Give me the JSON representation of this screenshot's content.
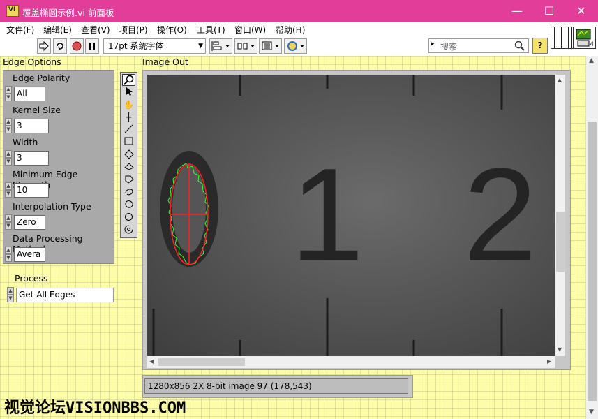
{
  "window": {
    "title": "覆盖椭圆示例.vi 前面板",
    "icon_text": "VI",
    "minimize_glyph": "—",
    "maximize_glyph": "☐",
    "close_glyph": "✕"
  },
  "menu": [
    "文件(F)",
    "编辑(E)",
    "查看(V)",
    "项目(P)",
    "操作(O)",
    "工具(T)",
    "窗口(W)",
    "帮助(H)"
  ],
  "toolbar": {
    "run_icon": "run-arrow-icon",
    "font": "17pt 系统字体",
    "search_placeholder": "搜索",
    "help_glyph": "?"
  },
  "vi_icon": {
    "text": "4"
  },
  "edge_options": {
    "title": "Edge Options",
    "fields": [
      {
        "label": "Edge Polarity",
        "value": "All"
      },
      {
        "label": "Kernel Size",
        "value": "3"
      },
      {
        "label": "Width",
        "value": "3"
      },
      {
        "label": "Minimum Edge Strength",
        "value": "10"
      },
      {
        "label": "Interpolation Type",
        "value": "Zero"
      },
      {
        "label": "Data Processing Method",
        "value": "Avera"
      }
    ]
  },
  "process": {
    "label": "Process",
    "value": "Get All Edges"
  },
  "image_out": {
    "label": "Image Out",
    "status": "1280x856 2X 8-bit image 97     (178,543)",
    "digits": [
      "1",
      "2"
    ]
  },
  "watermark": "视觉论坛VISIONBBS.COM",
  "colors": {
    "titlebar": "#e23d99",
    "panel": "#fdfda7",
    "overlay_red": "#ff2020",
    "overlay_green": "#30ff30"
  }
}
